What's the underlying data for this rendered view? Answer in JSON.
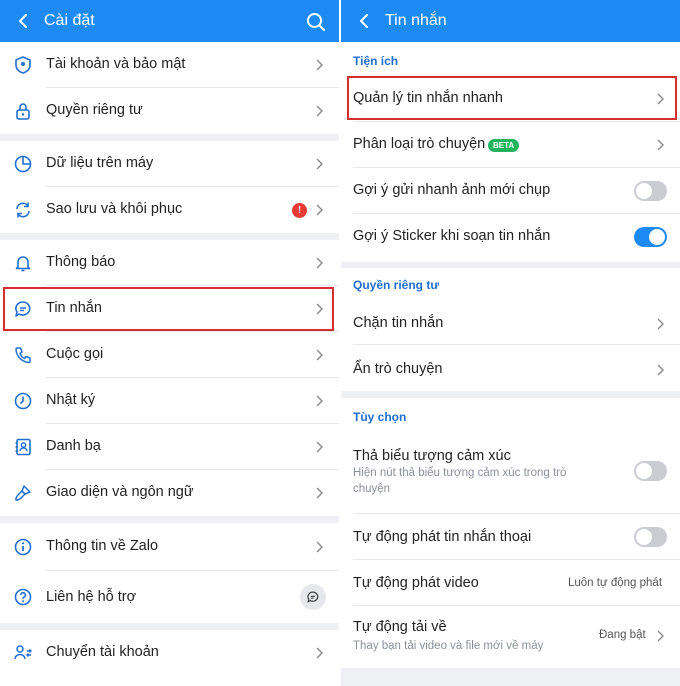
{
  "left": {
    "title": "Cài đặt",
    "items": [
      {
        "label": "Tài khoản và bảo mật",
        "icon": "shield-icon"
      },
      {
        "label": "Quyền riêng tư",
        "icon": "lock-icon"
      },
      {
        "label": "Dữ liệu trên máy",
        "icon": "pie-chart-icon"
      },
      {
        "label": "Sao lưu và khôi phục",
        "icon": "sync-icon"
      },
      {
        "label": "Thông báo",
        "icon": "bell-icon"
      },
      {
        "label": "Tin nhắn",
        "icon": "chat-bubble-icon"
      },
      {
        "label": "Cuộc gọi",
        "icon": "phone-icon"
      },
      {
        "label": "Nhật ký",
        "icon": "clock-icon"
      },
      {
        "label": "Danh bạ",
        "icon": "contacts-icon"
      },
      {
        "label": "Giao diện và ngôn ngữ",
        "icon": "paint-brush-icon"
      },
      {
        "label": "Thông tin về Zalo",
        "icon": "info-icon"
      },
      {
        "label": "Liên hệ hỗ trợ",
        "icon": "question-icon"
      },
      {
        "label": "Chuyển tài khoản",
        "icon": "switch-account-icon"
      }
    ],
    "alert_badge": "!"
  },
  "right": {
    "title": "Tin nhắn",
    "sections": {
      "utilities": "Tiện ích",
      "privacy": "Quyền riêng tư",
      "options": "Tùy chọn"
    },
    "items": {
      "quick_messages": "Quản lý tin nhắn nhanh",
      "classify": "Phân loại trò chuyện",
      "beta_badge": "BETA",
      "suggest_photo": "Gợi ý gửi nhanh ảnh mới chụp",
      "suggest_sticker": "Gợi ý Sticker khi soạn tin nhắn",
      "block": "Chặn tin nhắn",
      "hide_chat": "Ẩn trò chuyện",
      "reaction": "Thả biểu tượng cảm xúc",
      "reaction_desc_1": "Hiện nút thả biểu tượng cảm xúc trong trò",
      "reaction_desc_2": "chuyện",
      "auto_voice": "Tự động phát tin nhắn thoại",
      "auto_video": "Tự động phát video",
      "auto_video_value": "Luôn tự động phát",
      "auto_download": "Tự động tải về",
      "auto_download_desc": "Thay bạn tải video và file mới về máy",
      "auto_download_value": "Đang bật"
    },
    "toggles": {
      "suggest_photo": false,
      "suggest_sticker": true,
      "reaction": false,
      "auto_voice": false
    }
  },
  "colors": {
    "header": "#1e8bf5",
    "section_title": "#1e6fd1",
    "highlight": "#d32f2f",
    "beta": "#22b35e",
    "alert": "#e53935"
  }
}
